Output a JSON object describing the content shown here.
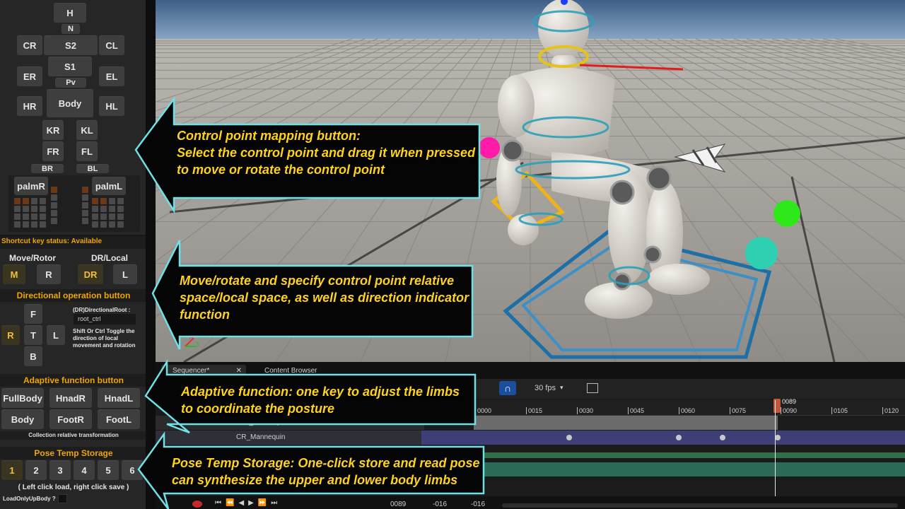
{
  "panel": {
    "body_map": {
      "h": "H",
      "n": "N",
      "cr": "CR",
      "s2": "S2",
      "cl": "CL",
      "s1": "S1",
      "er": "ER",
      "el": "EL",
      "pv": "Pv",
      "body": "Body",
      "hr": "HR",
      "hl": "HL",
      "kr": "KR",
      "kl": "KL",
      "fr": "FR",
      "fl": "FL",
      "br": "BR",
      "bl": "BL",
      "palm_r": "palmR",
      "palm_l": "palmL"
    },
    "shortcut_status": "Shortcut key status: Available",
    "move_rotor_label": "Move/Rotor",
    "dr_local_label": "DR/Local",
    "m": "M",
    "r": "R",
    "dr": "DR",
    "l": "L",
    "directional_title": "Directional operation button",
    "dir_f": "F",
    "dir_r": "R",
    "dir_t": "T",
    "dir_l": "L",
    "dir_b": "B",
    "directional_root_label": "(DR)DirectionalRoot :",
    "root_value": "root_ctrl",
    "toggle_note": "Shift Or Ctrl Toggle the direction of local movement and rotation",
    "adaptive_title": "Adaptive function button",
    "full_body": "FullBody",
    "hnad_r": "HnadR",
    "hnad_l": "HnadL",
    "body_btn": "Body",
    "foot_r": "FootR",
    "foot_l": "FootL",
    "collection_note": "Collection relative transformation",
    "pose_title": "Pose Temp Storage",
    "slots": [
      "1",
      "2",
      "3",
      "4",
      "5",
      "6"
    ],
    "pose_hint": "( Left click load, right click save )",
    "load_only_up": "LoadOnlyUpBody ?"
  },
  "sequencer": {
    "tab_sequencer": "Sequencer*",
    "tab_content_browser": "Content Browser",
    "fps": "30 fps",
    "playhead": "0089",
    "ticks": [
      "0000",
      "0015",
      "0030",
      "0045",
      "0060",
      "0075",
      "0090",
      "0105",
      "0120"
    ],
    "tracks": [
      "CR_Mannequin",
      "CR_Mannequin"
    ],
    "frame_current": "0089",
    "frame_start": "-016",
    "frame_end": "-016"
  },
  "callouts": {
    "c1_line1": "Control point mapping button:",
    "c1_line2": "Select the control point and drag it when pressed",
    "c1_line3": "to move or rotate the control point",
    "c2_line1": "Move/rotate and specify control point relative",
    "c2_line2": "space/local space, as well as direction indicator",
    "c2_line3": "function",
    "c3_line1": "Adaptive function: one key to adjust the limbs",
    "c3_line2": "to coordinate the posture",
    "c4_line1": "Pose Temp Storage: One-click store and read pose",
    "c4_line2": "can synthesize the upper and lower body limbs"
  },
  "colors": {
    "callout_fill": "#050505",
    "callout_border": "#6ee0e6",
    "callout_text": "#ffd21e",
    "section_title": "#f0a500"
  }
}
